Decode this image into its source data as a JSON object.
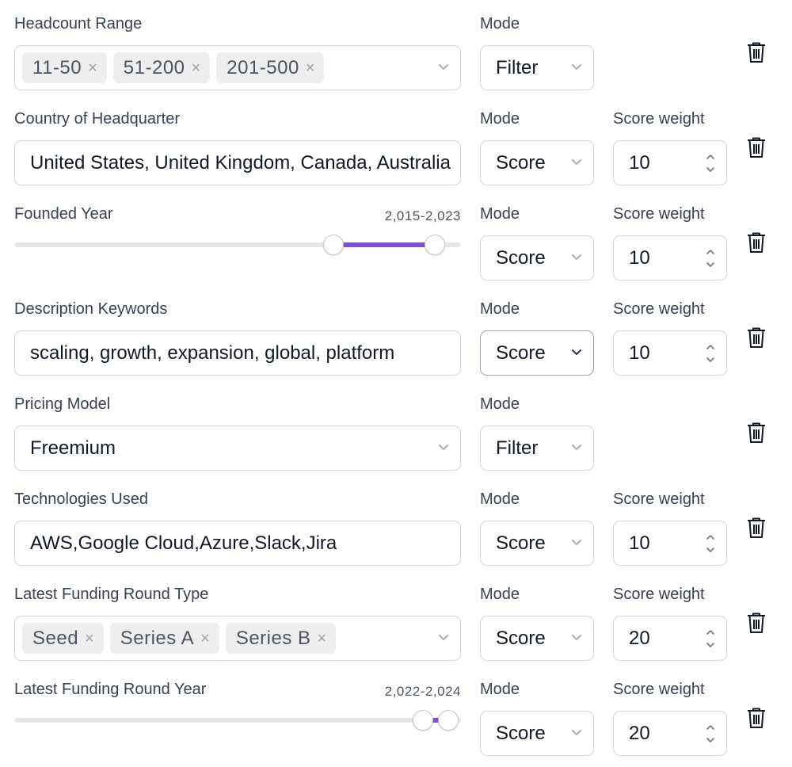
{
  "colors": {
    "accent": "#7c4fd8",
    "border": "#d1d5db",
    "chip_bg": "#eeeeee"
  },
  "icons": {
    "chevron": "chevron-down-icon",
    "delete": "trash-icon",
    "spinner": "spinner-arrows-icon",
    "chip_remove": "close-icon"
  },
  "labels": {
    "mode": "Mode",
    "score_weight": "Score weight"
  },
  "rows": [
    {
      "label": "Headcount Range",
      "chips": [
        "11-50",
        "51-200",
        "201-500"
      ],
      "chip_remove": "×",
      "mode": "Filter"
    },
    {
      "label": "Country of Headquarter",
      "value": "United States, United Kingdom, Canada, Australia",
      "mode": "Score",
      "weight": "10"
    },
    {
      "label": "Founded Year",
      "range_text": "2,015-2,023",
      "range": [
        2015,
        2023
      ],
      "mode": "Score",
      "weight": "10"
    },
    {
      "label": "Description Keywords",
      "value": "scaling, growth, expansion, global, platform",
      "mode": "Score",
      "weight": "10"
    },
    {
      "label": "Pricing Model",
      "value": "Freemium",
      "mode": "Filter"
    },
    {
      "label": "Technologies Used",
      "value": "AWS,Google Cloud,Azure,Slack,Jira",
      "mode": "Score",
      "weight": "10"
    },
    {
      "label": "Latest Funding Round Type",
      "chips": [
        "Seed",
        "Series A",
        "Series B"
      ],
      "chip_remove": "×",
      "mode": "Score",
      "weight": "20"
    },
    {
      "label": "Latest Funding Round Year",
      "range_text": "2,022-2,024",
      "range": [
        2022,
        2024
      ],
      "mode": "Score",
      "weight": "20"
    }
  ]
}
